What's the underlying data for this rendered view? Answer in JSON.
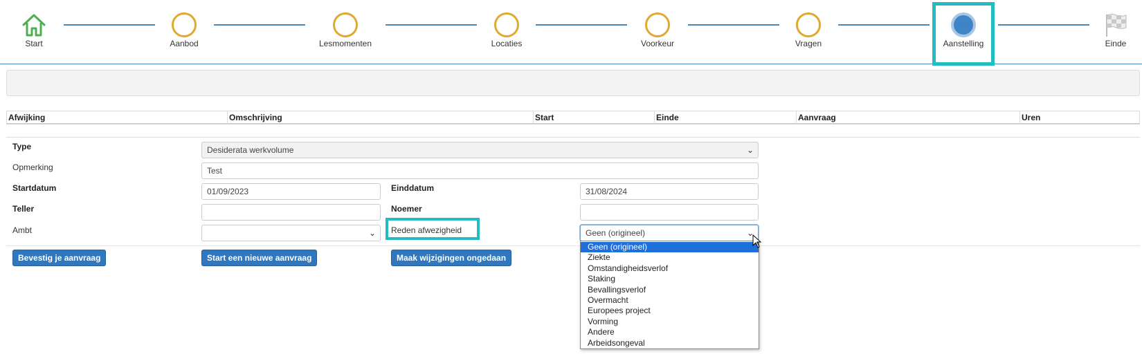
{
  "stepper": {
    "steps": [
      {
        "label": "Start",
        "icon": "home-icon"
      },
      {
        "label": "Aanbod"
      },
      {
        "label": "Lesmomenten"
      },
      {
        "label": "Locaties"
      },
      {
        "label": "Voorkeur"
      },
      {
        "label": "Vragen"
      },
      {
        "label": "Aanstelling",
        "current": true
      },
      {
        "label": "Einde",
        "icon": "checkered-flag-icon"
      }
    ],
    "colors": {
      "pending": "#e0a82e",
      "current": "#3f84c6",
      "home": "#4caf50",
      "line": "#4a86b8",
      "highlight": "#23bcc1"
    }
  },
  "table": {
    "headers": [
      "Afwijking",
      "Omschrijving",
      "Start",
      "Einde",
      "Aanvraag",
      "Uren"
    ]
  },
  "form": {
    "type": {
      "label": "Type",
      "value": "Desiderata werkvolume"
    },
    "opmerking": {
      "label": "Opmerking",
      "value": "Test"
    },
    "startdatum": {
      "label": "Startdatum",
      "value": "01/09/2023"
    },
    "einddatum": {
      "label": "Einddatum",
      "value": "31/08/2024"
    },
    "teller": {
      "label": "Teller",
      "value": ""
    },
    "noemer": {
      "label": "Noemer",
      "value": ""
    },
    "ambt": {
      "label": "Ambt",
      "value": ""
    },
    "reden": {
      "label": "Reden afwezigheid",
      "value": "Geen (origineel)",
      "options": [
        "Geen (origineel)",
        "Ziekte",
        "Omstandigheidsverlof",
        "Staking",
        "Bevallingsverlof",
        "Overmacht",
        "Europees project",
        "Vorming",
        "Andere",
        "Arbeidsongeval"
      ]
    }
  },
  "buttons": {
    "confirm": "Bevestig je aanvraag",
    "new": "Start een nieuwe aanvraag",
    "undo": "Maak wijzigingen ongedaan"
  }
}
